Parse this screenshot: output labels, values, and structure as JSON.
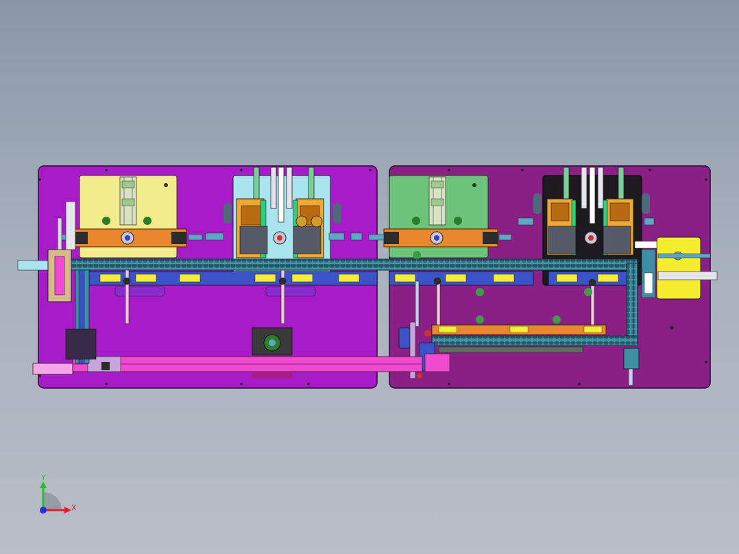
{
  "viewport": {
    "background_top": "#8a97a8",
    "background_bottom": "#b9bec7"
  },
  "colors": {
    "plate_left": "#a81bc8",
    "plate_right": "#8a1f86",
    "station_yellow": "#f3ec8c",
    "station_lightblue": "#a9e4ef",
    "station_green": "#6cc47a",
    "station_black": "#1c1a1e",
    "slider_orange": "#e8872c",
    "conveyor_teal": "#3e8fa4",
    "conveyor_blue": "#3b52c9",
    "conveyor_yellow": "#f4ee3a",
    "conveyor_pink": "#f04bd0",
    "gold_block": "#f0a830",
    "yellow_plate": "#f5ee2e",
    "rail_gray": "#9fa3ad"
  },
  "axis_triad": {
    "x_label": "X",
    "y_label": "Y",
    "x_color": "#e02020",
    "y_color": "#22c02a",
    "z_color": "#2030e0"
  }
}
